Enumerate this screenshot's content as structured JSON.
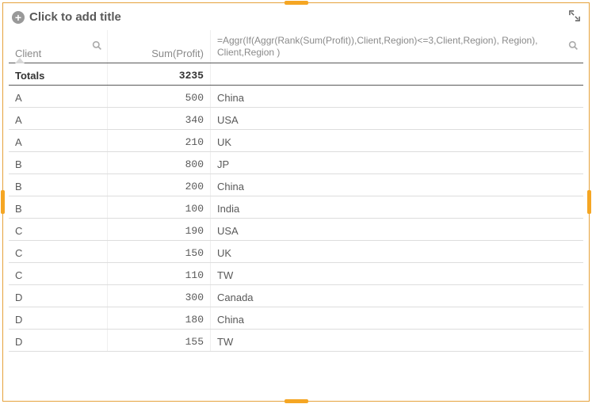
{
  "title_placeholder": "Click to add title",
  "columns": {
    "client_label": "Client",
    "profit_label": "Sum(Profit)",
    "expr_label": "=Aggr(If(Aggr(Rank(Sum(Profit)),Client,Region)<=3,Client,Region), Region), Client,Region )"
  },
  "totals": {
    "label": "Totals",
    "profit": "3235",
    "expr": ""
  },
  "rows": [
    {
      "client": "A",
      "profit": "500",
      "region": "China"
    },
    {
      "client": "A",
      "profit": "340",
      "region": "USA"
    },
    {
      "client": "A",
      "profit": "210",
      "region": "UK"
    },
    {
      "client": "B",
      "profit": "800",
      "region": "JP"
    },
    {
      "client": "B",
      "profit": "200",
      "region": "China"
    },
    {
      "client": "B",
      "profit": "100",
      "region": "India"
    },
    {
      "client": "C",
      "profit": "190",
      "region": "USA"
    },
    {
      "client": "C",
      "profit": "150",
      "region": "UK"
    },
    {
      "client": "C",
      "profit": "110",
      "region": "TW"
    },
    {
      "client": "D",
      "profit": "300",
      "region": "Canada"
    },
    {
      "client": "D",
      "profit": "180",
      "region": "China"
    },
    {
      "client": "D",
      "profit": "155",
      "region": "TW"
    }
  ]
}
